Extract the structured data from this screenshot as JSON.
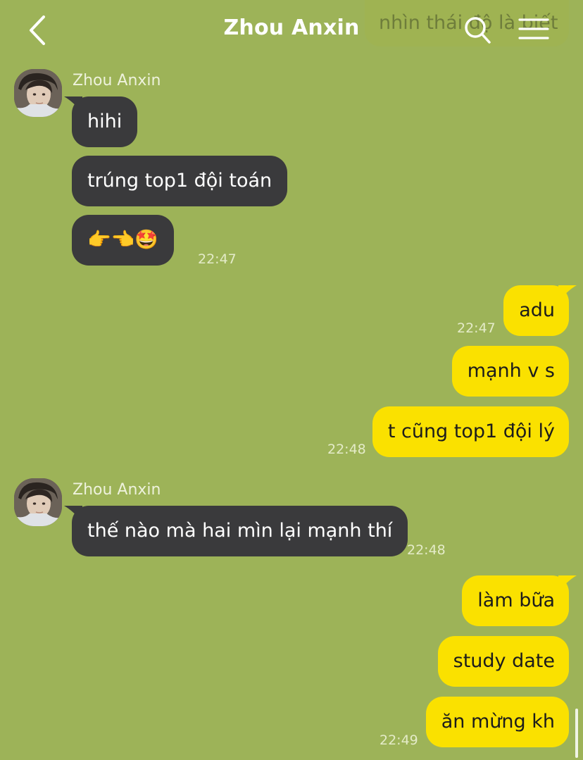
{
  "header": {
    "title": "Zhou Anxin",
    "peek_message": "nhìn thái độ là biết",
    "back_icon": "chevron-left-icon",
    "search_icon": "search-icon",
    "menu_icon": "hamburger-menu-icon"
  },
  "colors": {
    "background": "#9db358",
    "incoming_bubble": "#3a3a3c",
    "outgoing_bubble": "#fae100"
  },
  "messages": {
    "g1": {
      "sender": "Zhou Anxin",
      "m1": "hihi",
      "m2": "trúng top1 đội toán",
      "m3": "👉👈🤩",
      "time": "22:47"
    },
    "g2": {
      "m1": "adu",
      "time1": "22:47",
      "m2": "mạnh v s",
      "m3": "t cũng top1 đội lý",
      "time3": "22:48"
    },
    "g3": {
      "sender": "Zhou Anxin",
      "m1": "thế nào mà hai mìn lại mạnh thí",
      "time": "22:48"
    },
    "g4": {
      "m1": "làm bữa",
      "m2": "study date",
      "m3": "ăn mừng kh",
      "time": "22:49"
    }
  }
}
